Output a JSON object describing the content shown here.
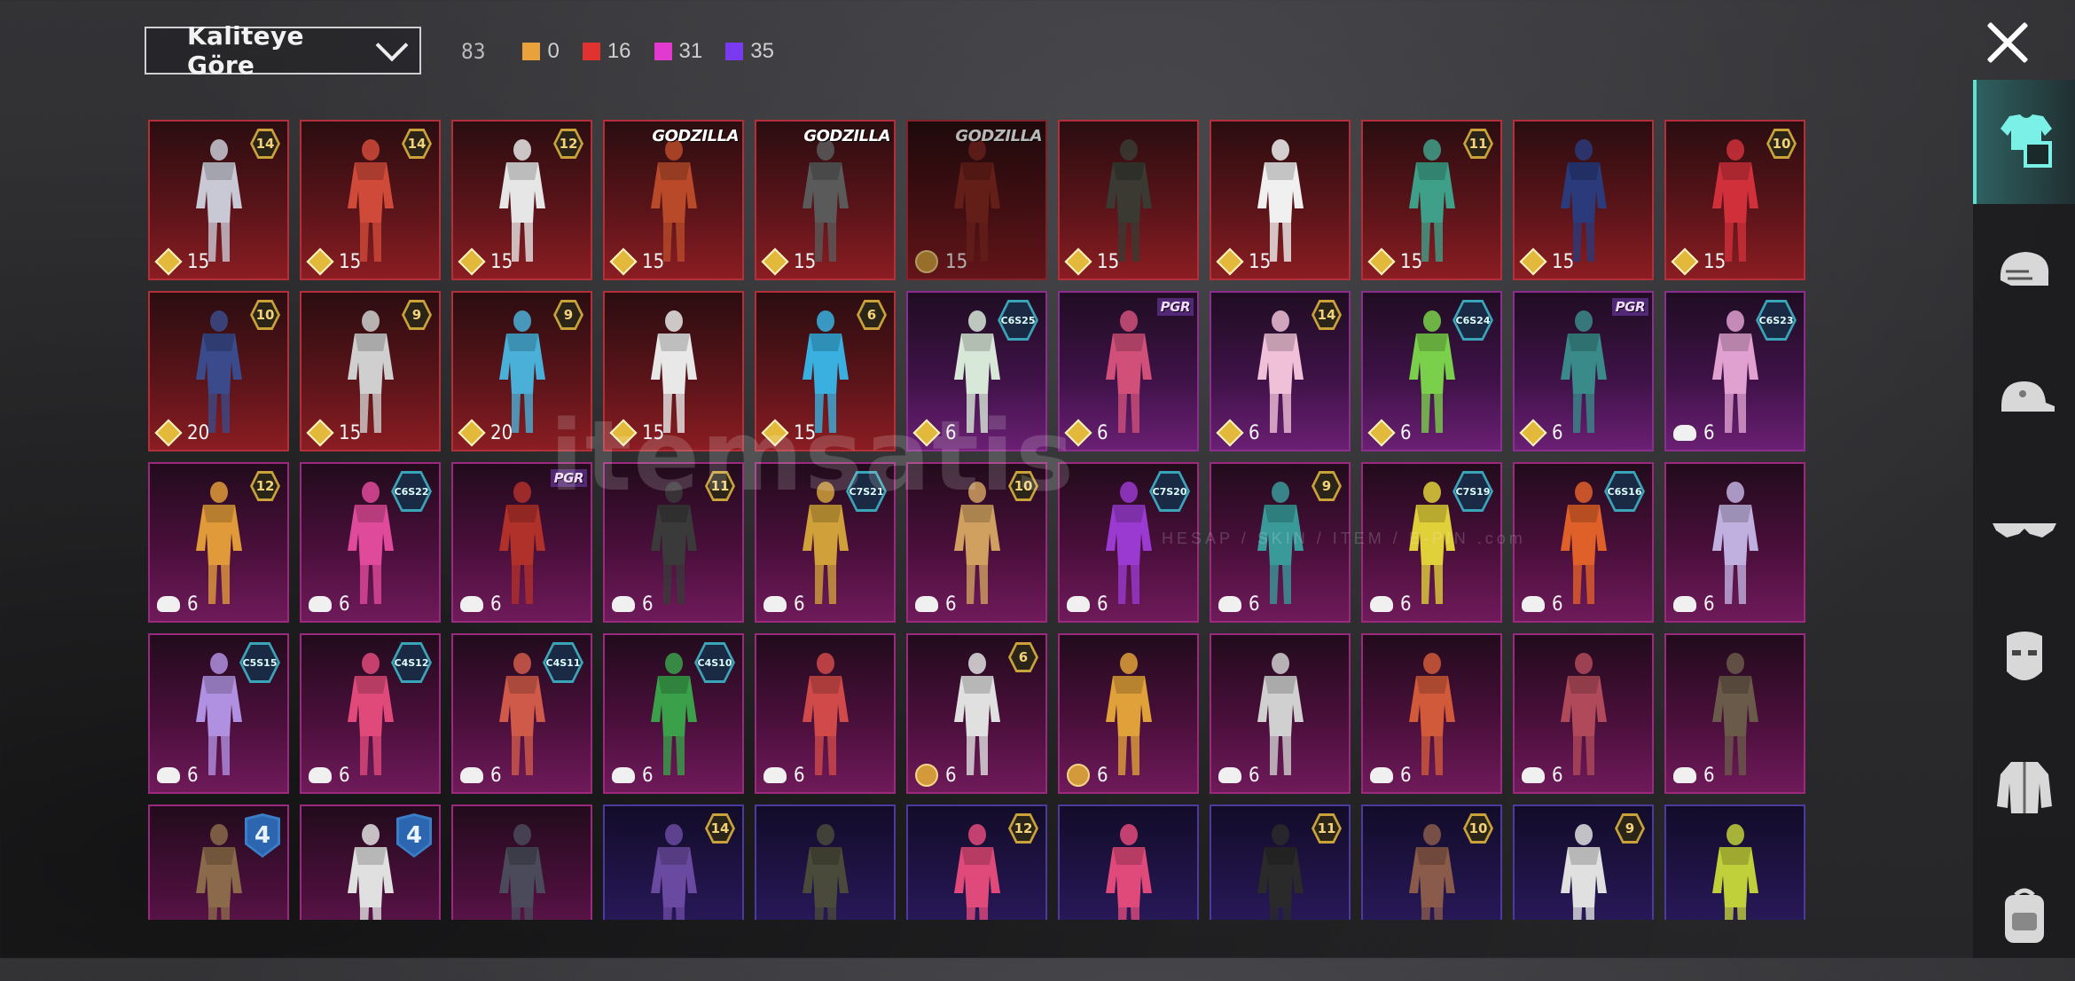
{
  "toolbar": {
    "sort_label": "Kaliteye Göre",
    "total": "83",
    "counts": [
      {
        "color": "#e9a23b",
        "value": "0"
      },
      {
        "color": "#e0332f",
        "value": "16"
      },
      {
        "color": "#e23ad1",
        "value": "31"
      },
      {
        "color": "#7a3bf0",
        "value": "35"
      }
    ]
  },
  "watermark": {
    "main": "itemsatis",
    "sub": "HESAP / SKIN / ITEM / E-PIN .com"
  },
  "rail": [
    "outfit-icon",
    "helmet-icon",
    "cap-icon",
    "glasses-icon",
    "mask-icon",
    "jacket-icon",
    "bag-icon"
  ],
  "items": [
    {
      "tier": "red",
      "badge": "14",
      "price": "15",
      "icon": "diamond",
      "color": "#c9c9d6"
    },
    {
      "tier": "red",
      "badge": "14",
      "price": "15",
      "icon": "diamond",
      "color": "#d04a3a"
    },
    {
      "tier": "red",
      "badge": "12",
      "price": "15",
      "icon": "diamond",
      "color": "#e6e6e6"
    },
    {
      "tier": "red",
      "tag": "GODZILLA",
      "price": "15",
      "icon": "diamond",
      "color": "#b84a2a"
    },
    {
      "tier": "red",
      "tag": "GODZILLA",
      "price": "15",
      "icon": "diamond",
      "color": "#5a5a5a"
    },
    {
      "tier": "red",
      "tag": "GODZILLA",
      "price": "15",
      "icon": "coin",
      "color": "#8a2a22",
      "dim": true
    },
    {
      "tier": "red",
      "price": "15",
      "icon": "diamond",
      "color": "#3a3a32"
    },
    {
      "tier": "red",
      "price": "15",
      "icon": "diamond",
      "color": "#f0f0f0"
    },
    {
      "tier": "red",
      "badge": "11",
      "price": "15",
      "icon": "diamond",
      "color": "#3fa08a"
    },
    {
      "tier": "red",
      "price": "15",
      "icon": "diamond",
      "color": "#2a3a7a"
    },
    {
      "tier": "red",
      "badge": "10",
      "price": "15",
      "icon": "diamond",
      "color": "#d0303a"
    },
    {
      "tier": "red",
      "badge": "10",
      "price": "20",
      "icon": "diamond",
      "color": "#3a4a8a"
    },
    {
      "tier": "red",
      "badge": "9",
      "price": "15",
      "icon": "diamond",
      "color": "#cfcfcf"
    },
    {
      "tier": "red",
      "badge": "9",
      "price": "20",
      "icon": "diamond",
      "color": "#4ab0d8"
    },
    {
      "tier": "red",
      "price": "15",
      "icon": "diamond",
      "color": "#e8e8e8"
    },
    {
      "tier": "red",
      "badge": "6",
      "price": "15",
      "icon": "diamond",
      "color": "#3ab0e0"
    },
    {
      "tier": "purple",
      "season": "C6S25",
      "price": "6",
      "icon": "diamond",
      "color": "#d8e8d8"
    },
    {
      "tier": "purple",
      "tag": "PGR",
      "price": "6",
      "icon": "diamond",
      "color": "#d0507a"
    },
    {
      "tier": "purple",
      "badge": "14",
      "price": "6",
      "icon": "diamond",
      "color": "#f0c0d8"
    },
    {
      "tier": "purple",
      "season": "C6S24",
      "price": "6",
      "icon": "diamond",
      "color": "#7ad04a"
    },
    {
      "tier": "purple",
      "tag": "PGR",
      "price": "6",
      "icon": "diamond",
      "color": "#3a8a8a"
    },
    {
      "tier": "purple",
      "season": "C6S23",
      "price": "6",
      "icon": "cloud",
      "color": "#e0a0d0"
    },
    {
      "tier": "magenta",
      "badge": "12",
      "price": "6",
      "icon": "cloud",
      "color": "#e09a3a"
    },
    {
      "tier": "magenta",
      "season": "C6S22",
      "price": "6",
      "icon": "cloud",
      "color": "#e04a9a"
    },
    {
      "tier": "magenta",
      "tag": "PGR",
      "price": "6",
      "icon": "cloud",
      "color": "#b0302a"
    },
    {
      "tier": "magenta",
      "badge": "11",
      "price": "6",
      "icon": "cloud",
      "color": "#3a3a3a"
    },
    {
      "tier": "magenta",
      "season": "C7S21",
      "price": "6",
      "icon": "cloud",
      "color": "#d0a03a"
    },
    {
      "tier": "magenta",
      "badge": "10",
      "price": "6",
      "icon": "cloud",
      "color": "#d0a060"
    },
    {
      "tier": "magenta",
      "season": "C7S20",
      "price": "6",
      "icon": "cloud",
      "color": "#9a3ad0"
    },
    {
      "tier": "magenta",
      "badge": "9",
      "price": "6",
      "icon": "cloud",
      "color": "#3a9a9a"
    },
    {
      "tier": "magenta",
      "season": "C7S19",
      "price": "6",
      "icon": "cloud",
      "color": "#e0d03a"
    },
    {
      "tier": "magenta",
      "season": "C6S16",
      "price": "6",
      "icon": "cloud",
      "color": "#e0602a"
    },
    {
      "tier": "magenta",
      "price": "6",
      "icon": "cloud",
      "color": "#c0b0e0"
    },
    {
      "tier": "magenta",
      "season": "C5S15",
      "price": "6",
      "icon": "cloud",
      "color": "#b090e0"
    },
    {
      "tier": "magenta",
      "season": "C4S12",
      "price": "6",
      "icon": "cloud",
      "color": "#e04a7a"
    },
    {
      "tier": "magenta",
      "season": "C4S11",
      "price": "6",
      "icon": "cloud",
      "color": "#d05a4a"
    },
    {
      "tier": "magenta",
      "season": "C4S10",
      "price": "6",
      "icon": "cloud",
      "color": "#3aa04a"
    },
    {
      "tier": "magenta",
      "price": "6",
      "icon": "cloud",
      "color": "#d04a4a"
    },
    {
      "tier": "magenta",
      "badge": "6",
      "price": "6",
      "icon": "coin",
      "color": "#e0e0e0"
    },
    {
      "tier": "magenta",
      "price": "6",
      "icon": "coin",
      "color": "#e0a03a"
    },
    {
      "tier": "magenta",
      "price": "6",
      "icon": "cloud",
      "color": "#d0d0d0"
    },
    {
      "tier": "magenta",
      "price": "6",
      "icon": "cloud",
      "color": "#d05a3a"
    },
    {
      "tier": "magenta",
      "price": "6",
      "icon": "cloud",
      "color": "#b04a5a"
    },
    {
      "tier": "magenta",
      "price": "6",
      "icon": "cloud",
      "color": "#6a5a4a"
    },
    {
      "tier": "magenta",
      "shield": "4",
      "color": "#8a6a4a"
    },
    {
      "tier": "magenta",
      "shield": "4",
      "color": "#e0e0e0"
    },
    {
      "tier": "magenta",
      "color": "#4a4a5a"
    },
    {
      "tier": "violet",
      "badge": "14",
      "color": "#6a4aa0"
    },
    {
      "tier": "violet",
      "color": "#4a4a3a"
    },
    {
      "tier": "violet",
      "badge": "12",
      "color": "#e04a7a"
    },
    {
      "tier": "violet",
      "color": "#e04a7a"
    },
    {
      "tier": "violet",
      "badge": "11",
      "color": "#2a2a2a"
    },
    {
      "tier": "violet",
      "badge": "10",
      "color": "#8a5a4a"
    },
    {
      "tier": "violet",
      "badge": "9",
      "color": "#e0e0e0"
    },
    {
      "tier": "violet",
      "color": "#c0d03a"
    }
  ]
}
